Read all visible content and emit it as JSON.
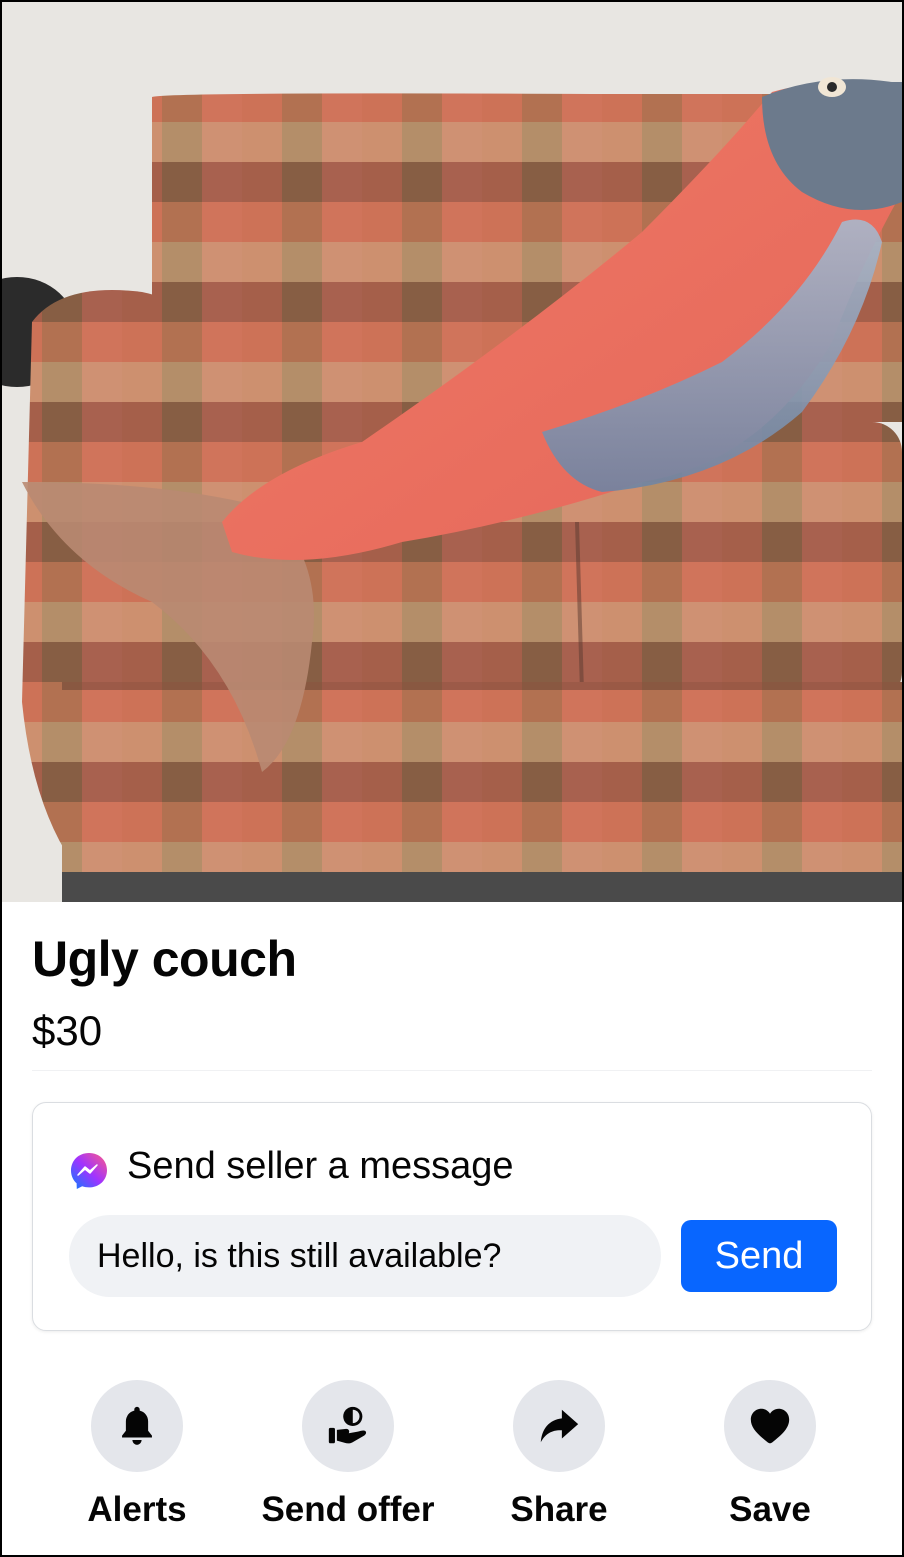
{
  "listing": {
    "title": "Ugly couch",
    "price": "$30",
    "photo_icon": "listing-photo"
  },
  "message": {
    "heading": "Send seller a message",
    "icon": "messenger-icon",
    "input_value": "Hello, is this still available?",
    "send_label": "Send"
  },
  "actions": [
    {
      "label": "Alerts",
      "icon": "bell-icon"
    },
    {
      "label": "Send offer",
      "icon": "send-offer-icon"
    },
    {
      "label": "Share",
      "icon": "share-icon"
    },
    {
      "label": "Save",
      "icon": "heart-icon"
    }
  ],
  "colors": {
    "accent": "#0866ff",
    "action_circle": "#e4e6eb",
    "input_bg": "#f0f2f5"
  }
}
